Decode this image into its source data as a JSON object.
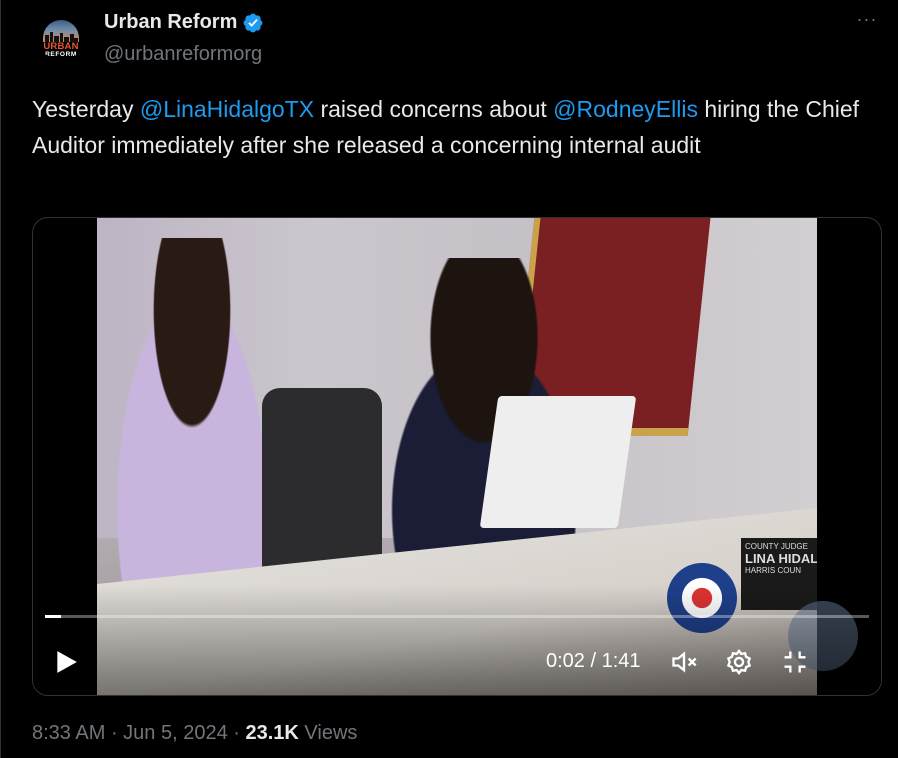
{
  "account": {
    "display_name": "Urban Reform",
    "handle": "@urbanreformorg",
    "verified_icon": "verified-badge-icon",
    "avatar_text_top": "URBAN",
    "avatar_text_bottom": "REFORM"
  },
  "post": {
    "text_prefix": "Yesterday ",
    "mention_1": "@LinaHidalgoTX",
    "text_middle": " raised concerns about ",
    "mention_2": "@RodneyEllis",
    "text_suffix": " hiring the Chief Auditor immediately after she released a concerning internal audit",
    "accent_color": "#1d9bf0"
  },
  "video": {
    "time_display": "0:02 / 1:41",
    "progress_fraction": 0.02,
    "nameplate_line1": "COUNTY JUDGE",
    "nameplate_line2": "LINA HIDAL",
    "nameplate_line3": "HARRIS COUN",
    "icons": [
      "play-icon",
      "mute-icon",
      "settings-gear-icon",
      "exit-fullscreen-icon"
    ]
  },
  "footer": {
    "time": "8:33 AM",
    "sep1": " · ",
    "date": "Jun 5, 2024",
    "sep2": " · ",
    "views_count": "23.1K",
    "views_label": " Views"
  },
  "menu": {
    "more_label": "···"
  }
}
